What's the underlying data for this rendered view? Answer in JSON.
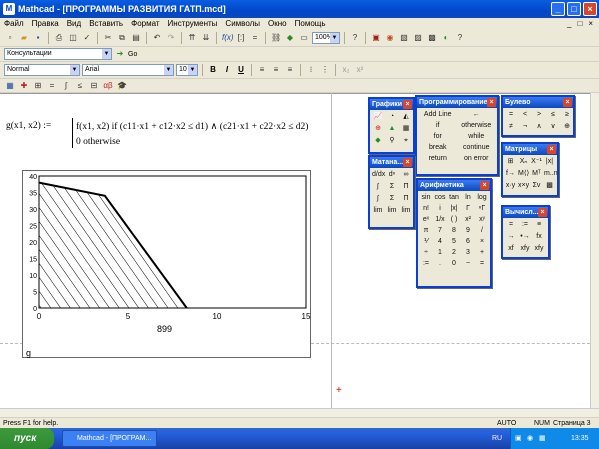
{
  "window": {
    "title": "Mathcad - [ПРОГРАММЫ РАЗВИТИЯ ГАТП.mcd]",
    "min_label": "_",
    "max_label": "□",
    "close_label": "×"
  },
  "menu": [
    "Файл",
    "Правка",
    "Вид",
    "Вставить",
    "Формат",
    "Инструменты",
    "Символы",
    "Окно",
    "Помощь"
  ],
  "mdi_controls": [
    "_",
    "□",
    "×"
  ],
  "toolbar": {
    "zoom": "100%",
    "resource_combo": "Консультации",
    "go_label": "Go",
    "style_combo": "Normal",
    "font_combo": "Arial",
    "size_combo": "10",
    "bold": "B",
    "italic": "I",
    "underline": "U"
  },
  "formula": {
    "lhs": "g(x1, x2) :=",
    "line1": "f(x1, x2)  if  (c11·x1 + c12·x2 ≤ d1) ∧ (c21·x1 + c22·x2 ≤ d2)",
    "line2": "0  otherwise"
  },
  "graph_label": "g",
  "chart_data": {
    "type": "area",
    "x": [
      0,
      3.7,
      8.3
    ],
    "y": [
      38,
      34,
      0
    ],
    "xlim": [
      0,
      15
    ],
    "ylim": [
      0,
      40
    ],
    "xticks": [
      "0",
      "5",
      "10",
      "15"
    ],
    "yticks": [
      "0",
      "5",
      "10",
      "15",
      "20",
      "25",
      "30",
      "35",
      "40"
    ],
    "xlabel": "899",
    "ylabel": "",
    "fill": "hatched",
    "grid": false
  },
  "palettes": {
    "graphs": {
      "title": "Графики"
    },
    "programming": {
      "title": "Программирование",
      "items": [
        "Add Line",
        "←",
        "if",
        "otherwise",
        "for",
        "while",
        "break",
        "continue",
        "return",
        "on error"
      ]
    },
    "boolean": {
      "title": "Булево",
      "items": [
        "=",
        "<",
        ">",
        "≤",
        "≥",
        "≠",
        "¬",
        "∧",
        "∨",
        "⊕"
      ]
    },
    "calculus": {
      "title": "Матана..."
    },
    "matrix": {
      "title": "Матрицы"
    },
    "arithmetic": {
      "title": "Арифметика",
      "items": [
        "sin",
        "cos",
        "tan",
        "ln",
        "log",
        "n!",
        "i",
        "|x|",
        "Γ",
        "ⁿΓ",
        "eˣ",
        "1/x",
        "( )",
        "x²",
        "xʸ",
        "π",
        "7",
        "8",
        "9",
        "/",
        "⅟",
        "4",
        "5",
        "6",
        "×",
        "÷",
        "1",
        "2",
        "3",
        "+",
        ":=",
        ".",
        "0",
        "−",
        "="
      ]
    },
    "evaluation": {
      "title": "Вычисл...",
      "items": [
        "=",
        ":=",
        "≡",
        "→",
        "•→",
        "fx",
        "xf",
        "xfy",
        "xfy"
      ]
    }
  },
  "status": {
    "help": "Press F1 for help.",
    "auto": "AUTO",
    "num": "NUM",
    "page": "Страница 3"
  },
  "taskbar": {
    "start": "пуск",
    "task": "Mathcad - [ПРОГРАМ...",
    "lang": "RU",
    "clock": "13:35"
  }
}
